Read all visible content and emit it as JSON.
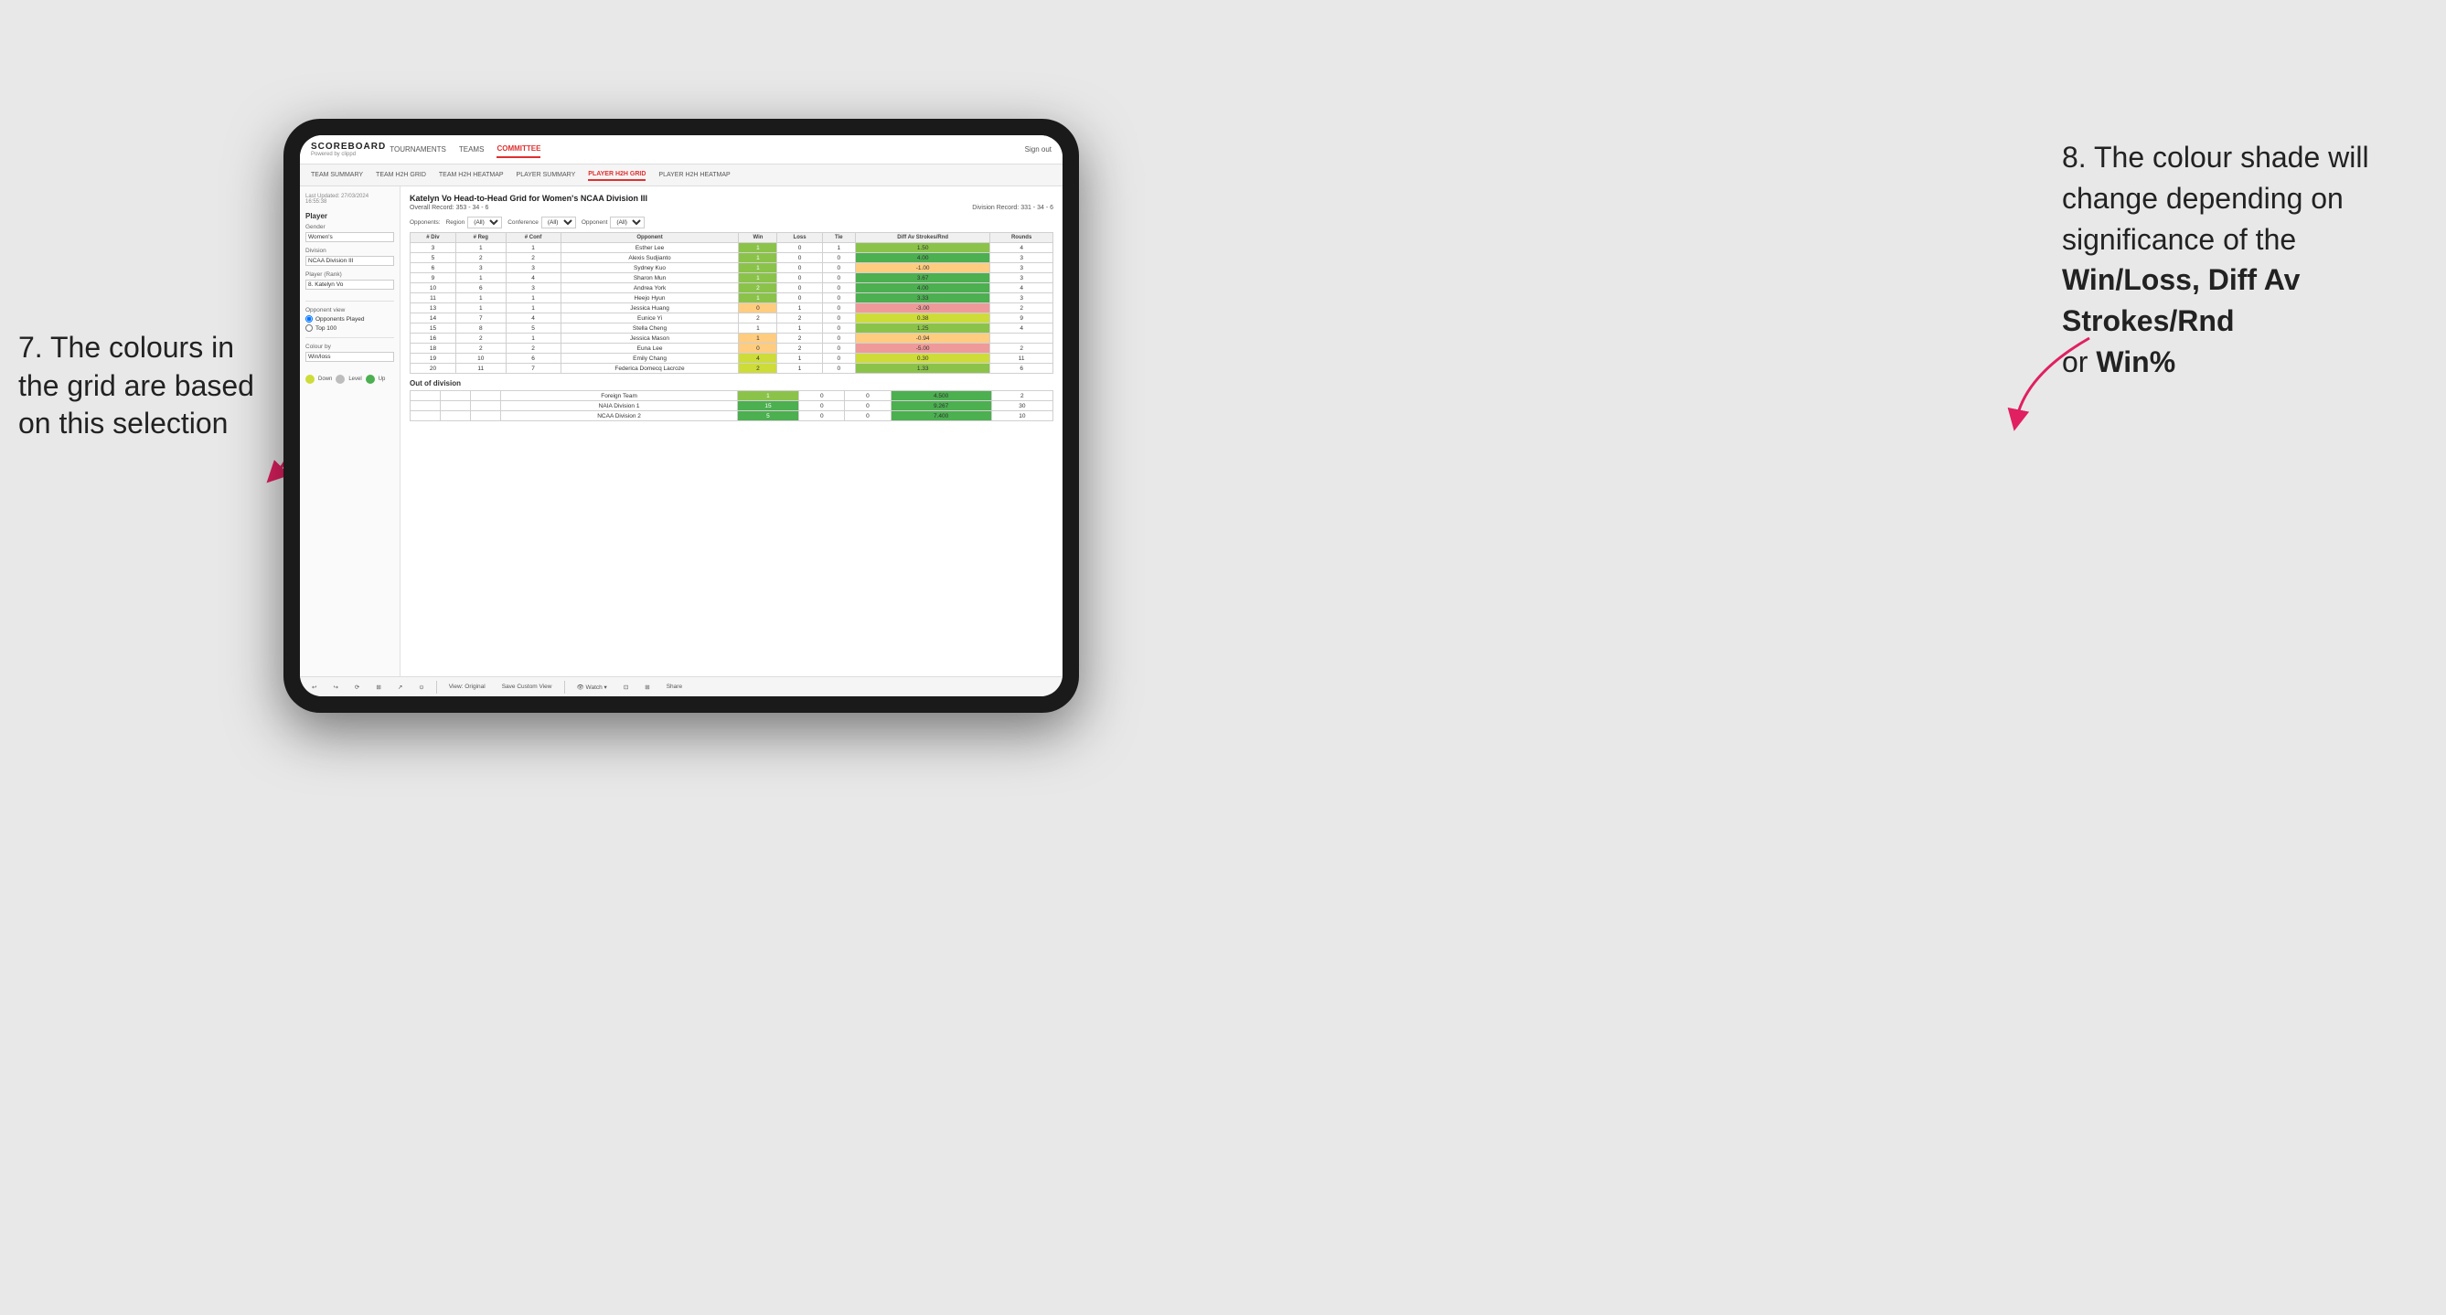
{
  "annotations": {
    "left_title": "7. The colours in the grid are based on this selection",
    "right_title": "8. The colour shade will change depending on significance of the",
    "right_bold1": "Win/Loss",
    "right_bold2": "Diff Av Strokes/Rnd",
    "right_bold3": "Win%",
    "right_suffix": "or"
  },
  "nav": {
    "logo": "SCOREBOARD",
    "logo_sub": "Powered by clippd",
    "items": [
      "TOURNAMENTS",
      "TEAMS",
      "COMMITTEE"
    ],
    "active": "COMMITTEE",
    "sign_out": "Sign out"
  },
  "sub_nav": {
    "items": [
      "TEAM SUMMARY",
      "TEAM H2H GRID",
      "TEAM H2H HEATMAP",
      "PLAYER SUMMARY",
      "PLAYER H2H GRID",
      "PLAYER H2H HEATMAP"
    ],
    "active": "PLAYER H2H GRID"
  },
  "sidebar": {
    "timestamp": "Last Updated: 27/03/2024\n16:55:38",
    "section": "Player",
    "gender_label": "Gender",
    "gender_value": "Women's",
    "division_label": "Division",
    "division_value": "NCAA Division III",
    "player_rank_label": "Player (Rank)",
    "player_rank_value": "8. Katelyn Vo",
    "opponent_view_label": "Opponent view",
    "opponent_played": "Opponents Played",
    "top_100": "Top 100",
    "colour_by_label": "Colour by",
    "colour_by_value": "Win/loss",
    "legend": {
      "down_label": "Down",
      "level_label": "Level",
      "up_label": "Up"
    }
  },
  "grid": {
    "title": "Katelyn Vo Head-to-Head Grid for Women's NCAA Division III",
    "overall_record": "Overall Record: 353 - 34 - 6",
    "division_record": "Division Record: 331 - 34 - 6",
    "filters": {
      "opponents_label": "Opponents:",
      "region_label": "Region",
      "region_value": "(All)",
      "conference_label": "Conference",
      "conference_value": "(All)",
      "opponent_label": "Opponent",
      "opponent_value": "(All)"
    },
    "headers": [
      "# Div",
      "# Reg",
      "# Conf",
      "Opponent",
      "Win",
      "Loss",
      "Tie",
      "Diff Av Strokes/Rnd",
      "Rounds"
    ],
    "rows": [
      {
        "div": "3",
        "reg": "1",
        "conf": "1",
        "opponent": "Esther Lee",
        "win": "1",
        "loss": "0",
        "tie": "1",
        "diff": "1.50",
        "rounds": "4",
        "win_color": "light",
        "diff_color": "light"
      },
      {
        "div": "5",
        "reg": "2",
        "conf": "2",
        "opponent": "Alexis Sudjianto",
        "win": "1",
        "loss": "0",
        "tie": "0",
        "diff": "4.00",
        "rounds": "3",
        "win_color": "mid",
        "diff_color": "mid"
      },
      {
        "div": "6",
        "reg": "3",
        "conf": "3",
        "opponent": "Sydney Kuo",
        "win": "1",
        "loss": "0",
        "tie": "0",
        "diff": "-1.00",
        "rounds": "3",
        "win_color": "light",
        "diff_color": "neutral"
      },
      {
        "div": "9",
        "reg": "1",
        "conf": "4",
        "opponent": "Sharon Mun",
        "win": "1",
        "loss": "0",
        "tie": "0",
        "diff": "3.67",
        "rounds": "3",
        "win_color": "mid",
        "diff_color": "mid"
      },
      {
        "div": "10",
        "reg": "6",
        "conf": "3",
        "opponent": "Andrea York",
        "win": "2",
        "loss": "0",
        "tie": "0",
        "diff": "4.00",
        "rounds": "4",
        "win_color": "mid",
        "diff_color": "mid"
      },
      {
        "div": "11",
        "reg": "1",
        "conf": "1",
        "opponent": "Heejo Hyun",
        "win": "1",
        "loss": "0",
        "tie": "0",
        "diff": "3.33",
        "rounds": "3",
        "win_color": "light",
        "diff_color": "light"
      },
      {
        "div": "13",
        "reg": "1",
        "conf": "1",
        "opponent": "Jessica Huang",
        "win": "0",
        "loss": "1",
        "tie": "0",
        "diff": "-3.00",
        "rounds": "2",
        "win_color": "loss",
        "diff_color": "loss"
      },
      {
        "div": "14",
        "reg": "7",
        "conf": "4",
        "opponent": "Eunice Yi",
        "win": "2",
        "loss": "2",
        "tie": "0",
        "diff": "0.38",
        "rounds": "9",
        "win_color": "light",
        "diff_color": "neutral"
      },
      {
        "div": "15",
        "reg": "8",
        "conf": "5",
        "opponent": "Stella Cheng",
        "win": "1",
        "loss": "1",
        "tie": "0",
        "diff": "1.25",
        "rounds": "4",
        "win_color": "light",
        "diff_color": "light"
      },
      {
        "div": "16",
        "reg": "2",
        "conf": "1",
        "opponent": "Jessica Mason",
        "win": "1",
        "loss": "2",
        "tie": "0",
        "diff": "-0.94",
        "rounds": "",
        "win_color": "loss_light",
        "diff_color": "neutral"
      },
      {
        "div": "18",
        "reg": "2",
        "conf": "2",
        "opponent": "Euna Lee",
        "win": "0",
        "loss": "2",
        "tie": "0",
        "diff": "-5.00",
        "rounds": "2",
        "win_color": "loss_strong",
        "diff_color": "loss_strong"
      },
      {
        "div": "19",
        "reg": "10",
        "conf": "6",
        "opponent": "Emily Chang",
        "win": "4",
        "loss": "1",
        "tie": "0",
        "diff": "0.30",
        "rounds": "11",
        "win_color": "mid",
        "diff_color": "neutral"
      },
      {
        "div": "20",
        "reg": "11",
        "conf": "7",
        "opponent": "Federica Domecq Lacroze",
        "win": "2",
        "loss": "1",
        "tie": "0",
        "diff": "1.33",
        "rounds": "6",
        "win_color": "light",
        "diff_color": "light"
      }
    ],
    "out_of_division": {
      "title": "Out of division",
      "rows": [
        {
          "opponent": "Foreign Team",
          "win": "1",
          "loss": "0",
          "tie": "0",
          "diff": "4.500",
          "rounds": "2",
          "win_color": "mid",
          "diff_color": "mid"
        },
        {
          "opponent": "NAIA Division 1",
          "win": "15",
          "loss": "0",
          "tie": "0",
          "diff": "9.267",
          "rounds": "30",
          "win_color": "strong",
          "diff_color": "strong"
        },
        {
          "opponent": "NCAA Division 2",
          "win": "5",
          "loss": "0",
          "tie": "0",
          "diff": "7.400",
          "rounds": "10",
          "win_color": "strong",
          "diff_color": "strong"
        }
      ]
    }
  },
  "toolbar": {
    "buttons": [
      "↩",
      "↪",
      "⟳",
      "⊞",
      "↗",
      "⊙",
      "|",
      "View: Original",
      "Save Custom View",
      "👁 Watch ▾",
      "⊡",
      "⊞",
      "Share"
    ]
  }
}
